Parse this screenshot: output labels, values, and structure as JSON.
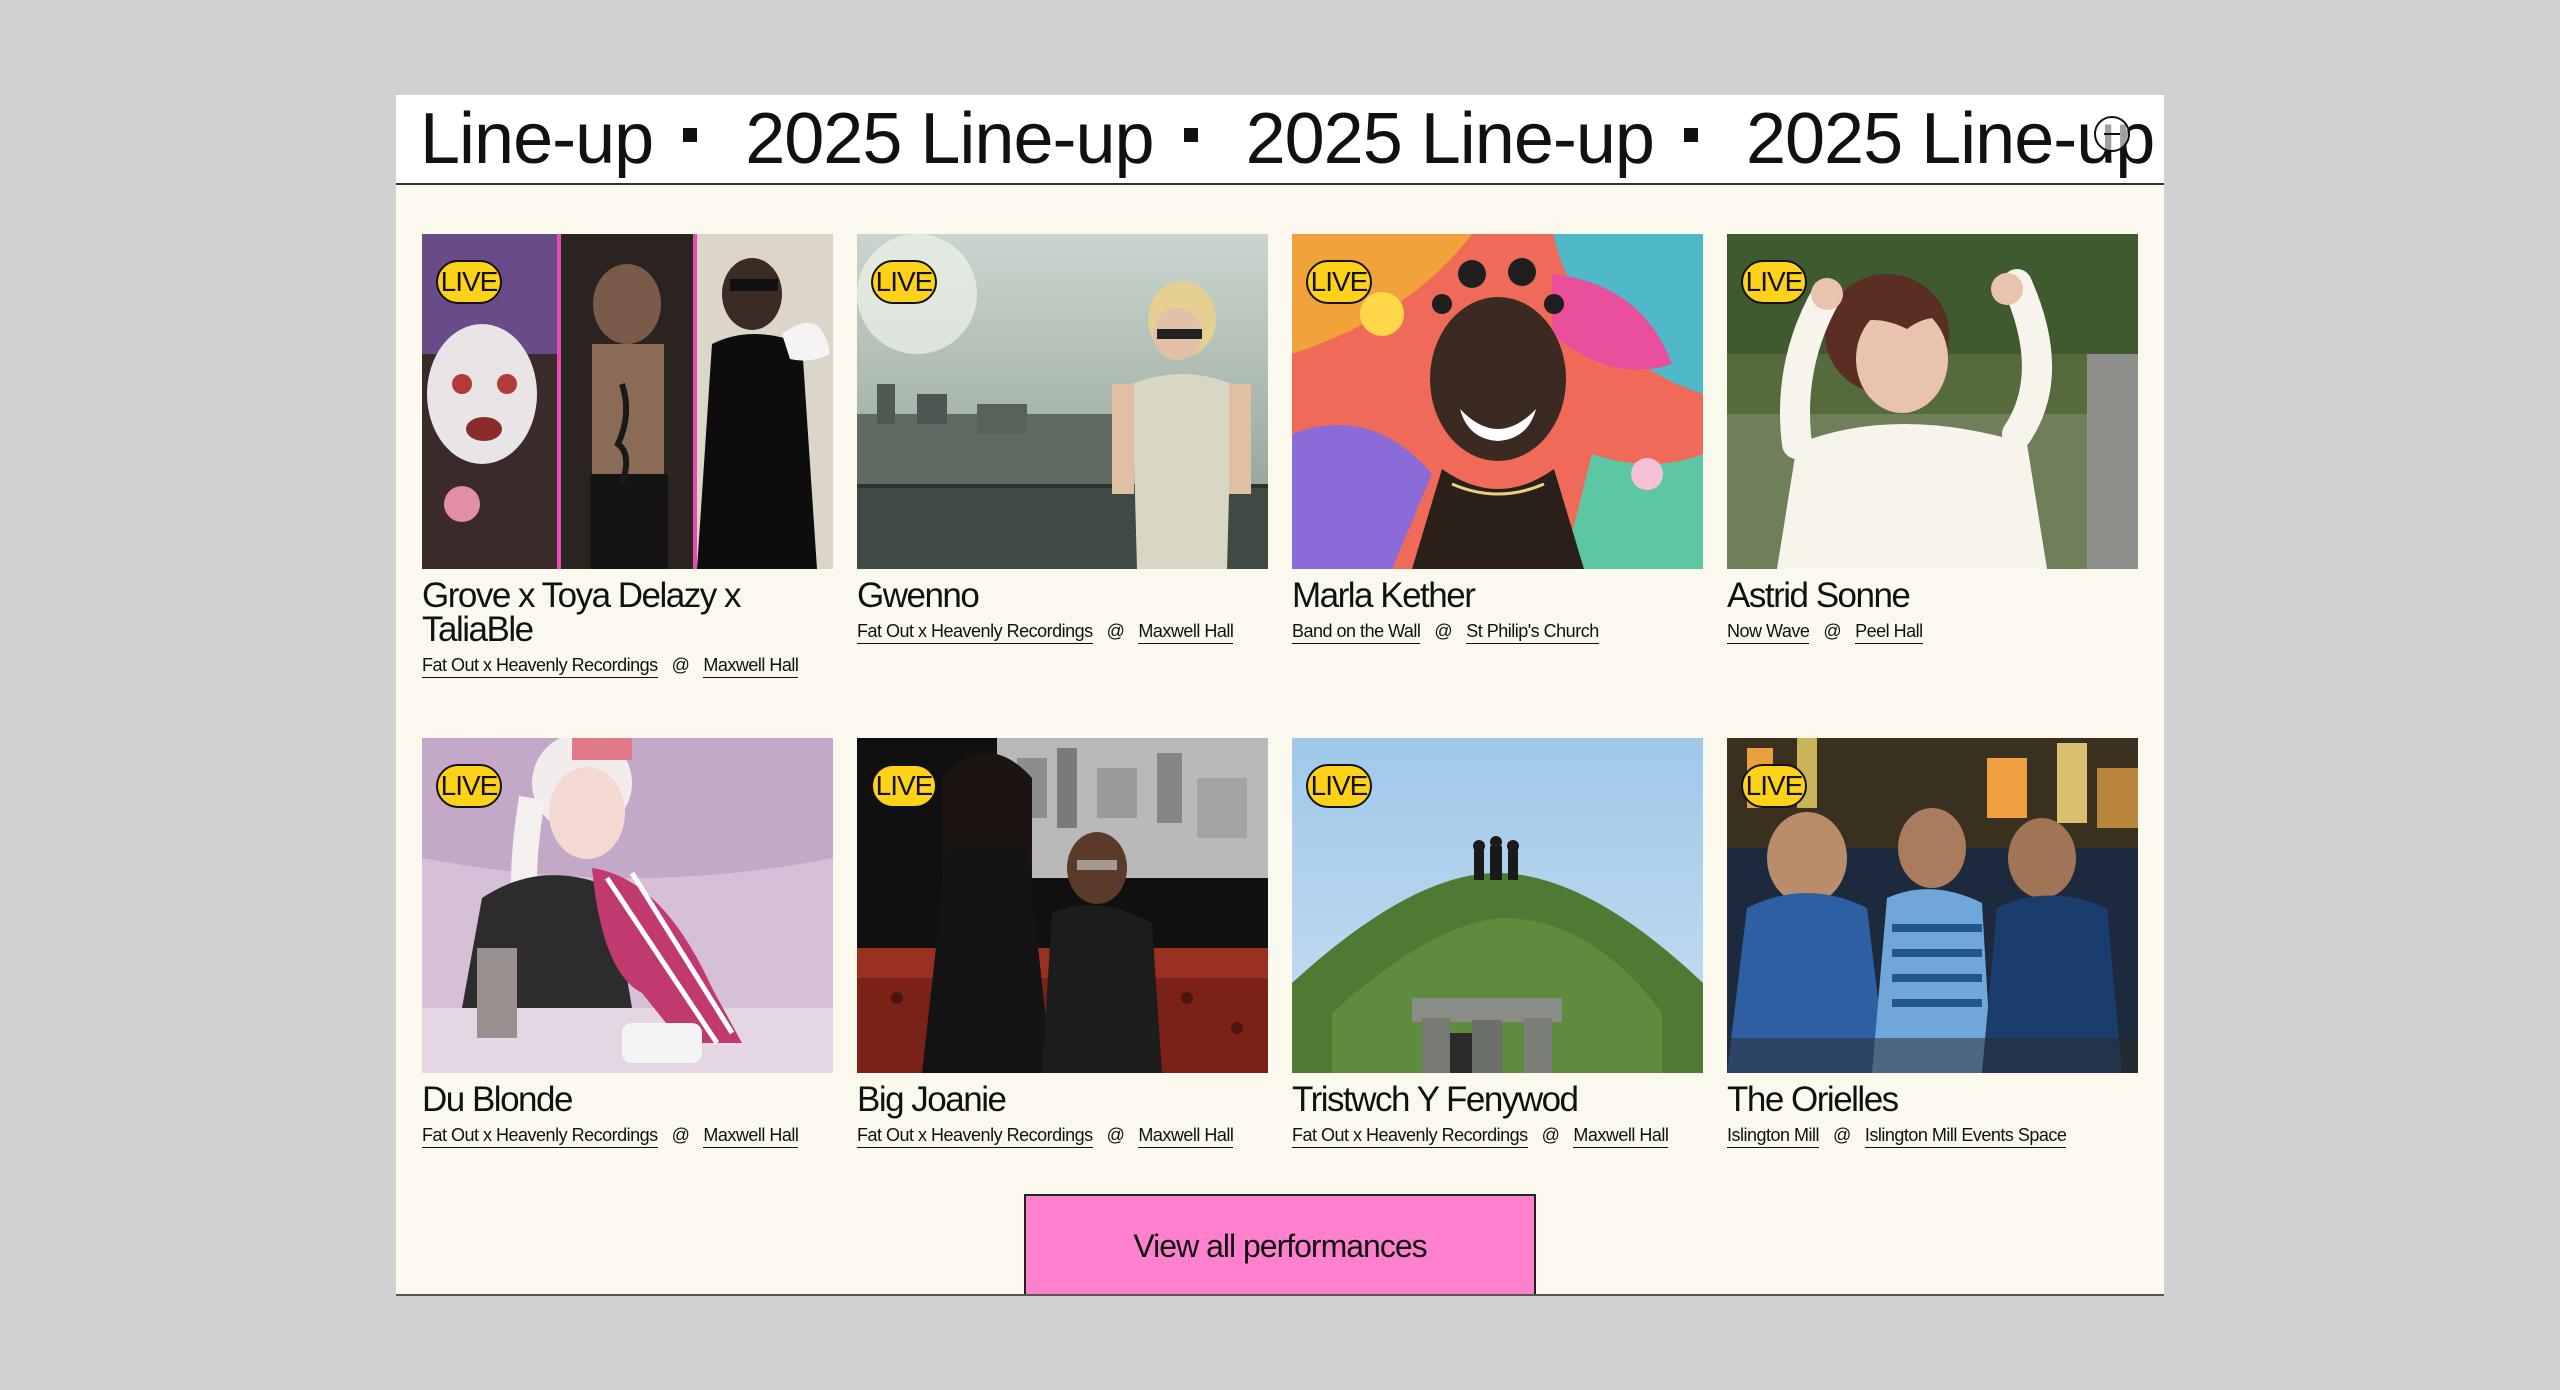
{
  "ticker": {
    "items": [
      "Line-up",
      "2025 Line-up",
      "2025 Line-up",
      "2025 Line-up"
    ]
  },
  "collapse_icon": "minus-circle-icon",
  "performances": [
    {
      "name": "Grove x Toya Delazy x TaliaBle",
      "badge": "LIVE",
      "promoter": "Fat Out x Heavenly Recordings",
      "at": "@",
      "venue": "Maxwell Hall"
    },
    {
      "name": "Gwenno",
      "badge": "LIVE",
      "promoter": "Fat Out x Heavenly Recordings",
      "at": "@",
      "venue": "Maxwell Hall"
    },
    {
      "name": "Marla Kether",
      "badge": "LIVE",
      "promoter": "Band on the Wall",
      "at": "@",
      "venue": "St Philip's Church"
    },
    {
      "name": "Astrid Sonne",
      "badge": "LIVE",
      "promoter": "Now Wave",
      "at": "@",
      "venue": "Peel Hall"
    },
    {
      "name": "Du Blonde",
      "badge": "LIVE",
      "promoter": "Fat Out x Heavenly Recordings",
      "at": "@",
      "venue": "Maxwell Hall"
    },
    {
      "name": "Big Joanie",
      "badge": "LIVE",
      "promoter": "Fat Out x Heavenly Recordings",
      "at": "@",
      "venue": "Maxwell Hall"
    },
    {
      "name": "Tristwch Y Fenywod",
      "badge": "LIVE",
      "promoter": "Fat Out x Heavenly Recordings",
      "at": "@",
      "venue": "Maxwell Hall"
    },
    {
      "name": "The Orielles",
      "badge": "LIVE",
      "promoter": "Islington Mill",
      "at": "@",
      "venue": "Islington Mill Events Space"
    }
  ],
  "view_all_label": "View all performances",
  "colors": {
    "panel_bg": "#fbf9ee",
    "badge": "#ffd21a",
    "cta": "#ff80cc"
  }
}
